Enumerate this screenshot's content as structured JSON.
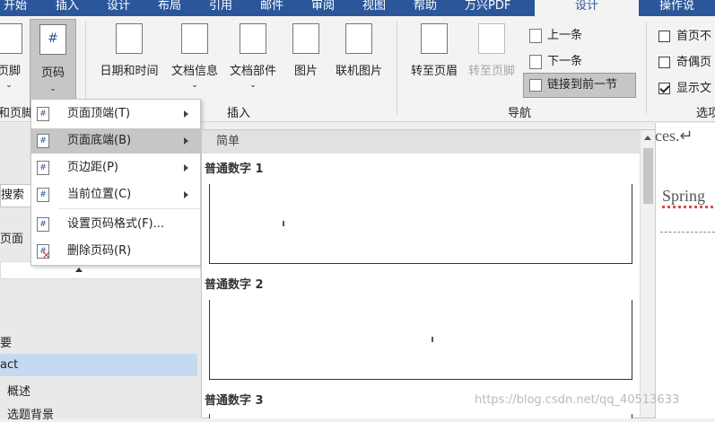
{
  "tabs": {
    "start": "开始",
    "insert": "插入",
    "design": "设计",
    "layout": "布局",
    "references": "引用",
    "mailings": "邮件",
    "review": "审阅",
    "view": "视图",
    "help": "帮助",
    "pdf": "万兴PDF",
    "hf_design": "设计",
    "tell_me": "操作说"
  },
  "ribbon": {
    "footer": "页脚",
    "page_number": "页码",
    "date_time": "日期和时间",
    "doc_info": "文档信息",
    "doc_parts": "文档部件",
    "picture": "图片",
    "online_picture": "联机图片",
    "goto_header": "转至页眉",
    "goto_footer": "转至页脚",
    "prev": "上一条",
    "next": "下一条",
    "link_prev": "链接到前一节",
    "group_hf": "和页脚",
    "group_insert": "插入",
    "group_nav": "导航",
    "group_options": "选项",
    "opt_first_page": "首页不",
    "opt_odd_even": "奇偶页",
    "opt_show_doc": "显示文"
  },
  "page_menu": {
    "items": [
      {
        "label": "页面顶端(T)",
        "icon": "#"
      },
      {
        "label": "页面底端(B)",
        "icon": "#"
      },
      {
        "label": "页边距(P)",
        "icon": "#"
      },
      {
        "label": "当前位置(C)",
        "icon": "#"
      },
      {
        "label": "设置页码格式(F)...",
        "icon": "#"
      },
      {
        "label": "删除页码(R)",
        "icon": "#"
      }
    ]
  },
  "gallery": {
    "header": "简单",
    "items": [
      "普通数字 1",
      "普通数字 2",
      "普通数字 3"
    ]
  },
  "left_pane": {
    "search": "搜索",
    "pages": "页面",
    "outline": [
      "要",
      "act",
      "概述",
      "选题背景"
    ]
  },
  "document": {
    "line1": "ces.↵",
    "line2": "Spring"
  },
  "watermark": "https://blog.csdn.net/qq_40513633"
}
